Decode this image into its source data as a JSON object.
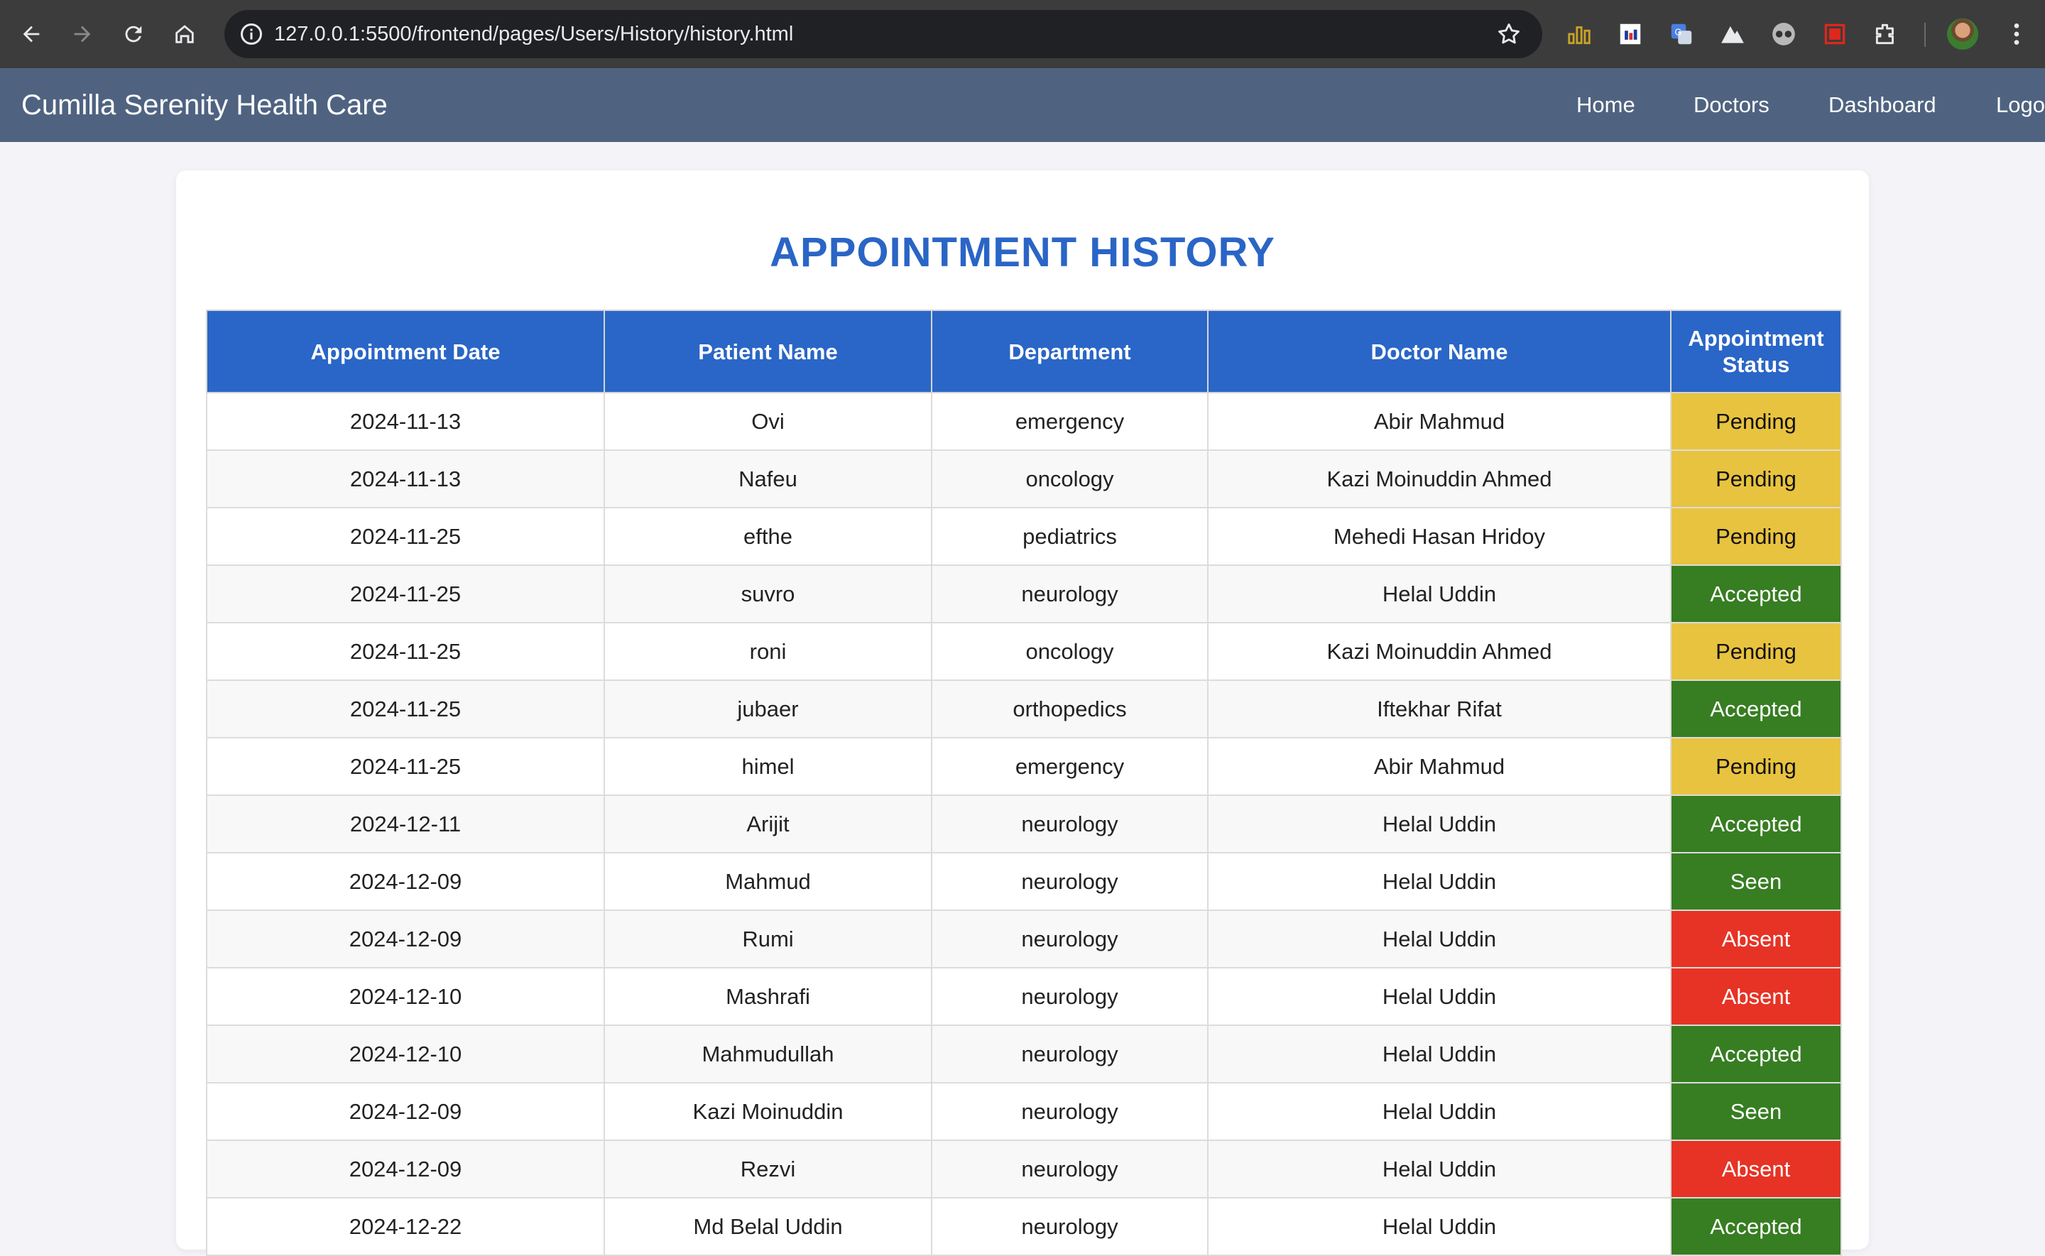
{
  "browser": {
    "url": "127.0.0.1:5500/frontend/pages/Users/History/history.html",
    "icons": [
      "back-icon",
      "forward-icon",
      "reload-icon",
      "home-icon",
      "info-icon",
      "star-icon",
      "extensions-icon",
      "menu-icon"
    ]
  },
  "navbar": {
    "brand": "Cumilla Serenity Health Care",
    "links": [
      "Home",
      "Doctors",
      "Dashboard",
      "Logo"
    ]
  },
  "page": {
    "title": "APPOINTMENT HISTORY"
  },
  "table": {
    "headers": [
      "Appointment Date",
      "Patient Name",
      "Department",
      "Doctor Name",
      "Appointment Status"
    ],
    "rows": [
      {
        "date": "2024-11-13",
        "patient": "Ovi",
        "department": "emergency",
        "doctor": "Abir Mahmud",
        "status": "Pending"
      },
      {
        "date": "2024-11-13",
        "patient": "Nafeu",
        "department": "oncology",
        "doctor": "Kazi Moinuddin Ahmed",
        "status": "Pending"
      },
      {
        "date": "2024-11-25",
        "patient": "efthe",
        "department": "pediatrics",
        "doctor": "Mehedi Hasan Hridoy",
        "status": "Pending"
      },
      {
        "date": "2024-11-25",
        "patient": "suvro",
        "department": "neurology",
        "doctor": "Helal Uddin",
        "status": "Accepted"
      },
      {
        "date": "2024-11-25",
        "patient": "roni",
        "department": "oncology",
        "doctor": "Kazi Moinuddin Ahmed",
        "status": "Pending"
      },
      {
        "date": "2024-11-25",
        "patient": "jubaer",
        "department": "orthopedics",
        "doctor": "Iftekhar Rifat",
        "status": "Accepted"
      },
      {
        "date": "2024-11-25",
        "patient": "himel",
        "department": "emergency",
        "doctor": "Abir Mahmud",
        "status": "Pending"
      },
      {
        "date": "2024-12-11",
        "patient": "Arijit",
        "department": "neurology",
        "doctor": "Helal Uddin",
        "status": "Accepted"
      },
      {
        "date": "2024-12-09",
        "patient": "Mahmud",
        "department": "neurology",
        "doctor": "Helal Uddin",
        "status": "Seen"
      },
      {
        "date": "2024-12-09",
        "patient": "Rumi",
        "department": "neurology",
        "doctor": "Helal Uddin",
        "status": "Absent"
      },
      {
        "date": "2024-12-10",
        "patient": "Mashrafi",
        "department": "neurology",
        "doctor": "Helal Uddin",
        "status": "Absent"
      },
      {
        "date": "2024-12-10",
        "patient": "Mahmudullah",
        "department": "neurology",
        "doctor": "Helal Uddin",
        "status": "Accepted"
      },
      {
        "date": "2024-12-09",
        "patient": "Kazi Moinuddin",
        "department": "neurology",
        "doctor": "Helal Uddin",
        "status": "Seen"
      },
      {
        "date": "2024-12-09",
        "patient": "Rezvi",
        "department": "neurology",
        "doctor": "Helal Uddin",
        "status": "Absent"
      },
      {
        "date": "2024-12-22",
        "patient": "Md Belal Uddin",
        "department": "neurology",
        "doctor": "Helal Uddin",
        "status": "Accepted"
      }
    ]
  },
  "colors": {
    "navbar": "#4f6381",
    "header": "#2a66c7",
    "title": "#2a65c6",
    "pending": "#e8c33f",
    "accepted": "#377d22",
    "seen": "#377d22",
    "absent": "#e63325"
  }
}
